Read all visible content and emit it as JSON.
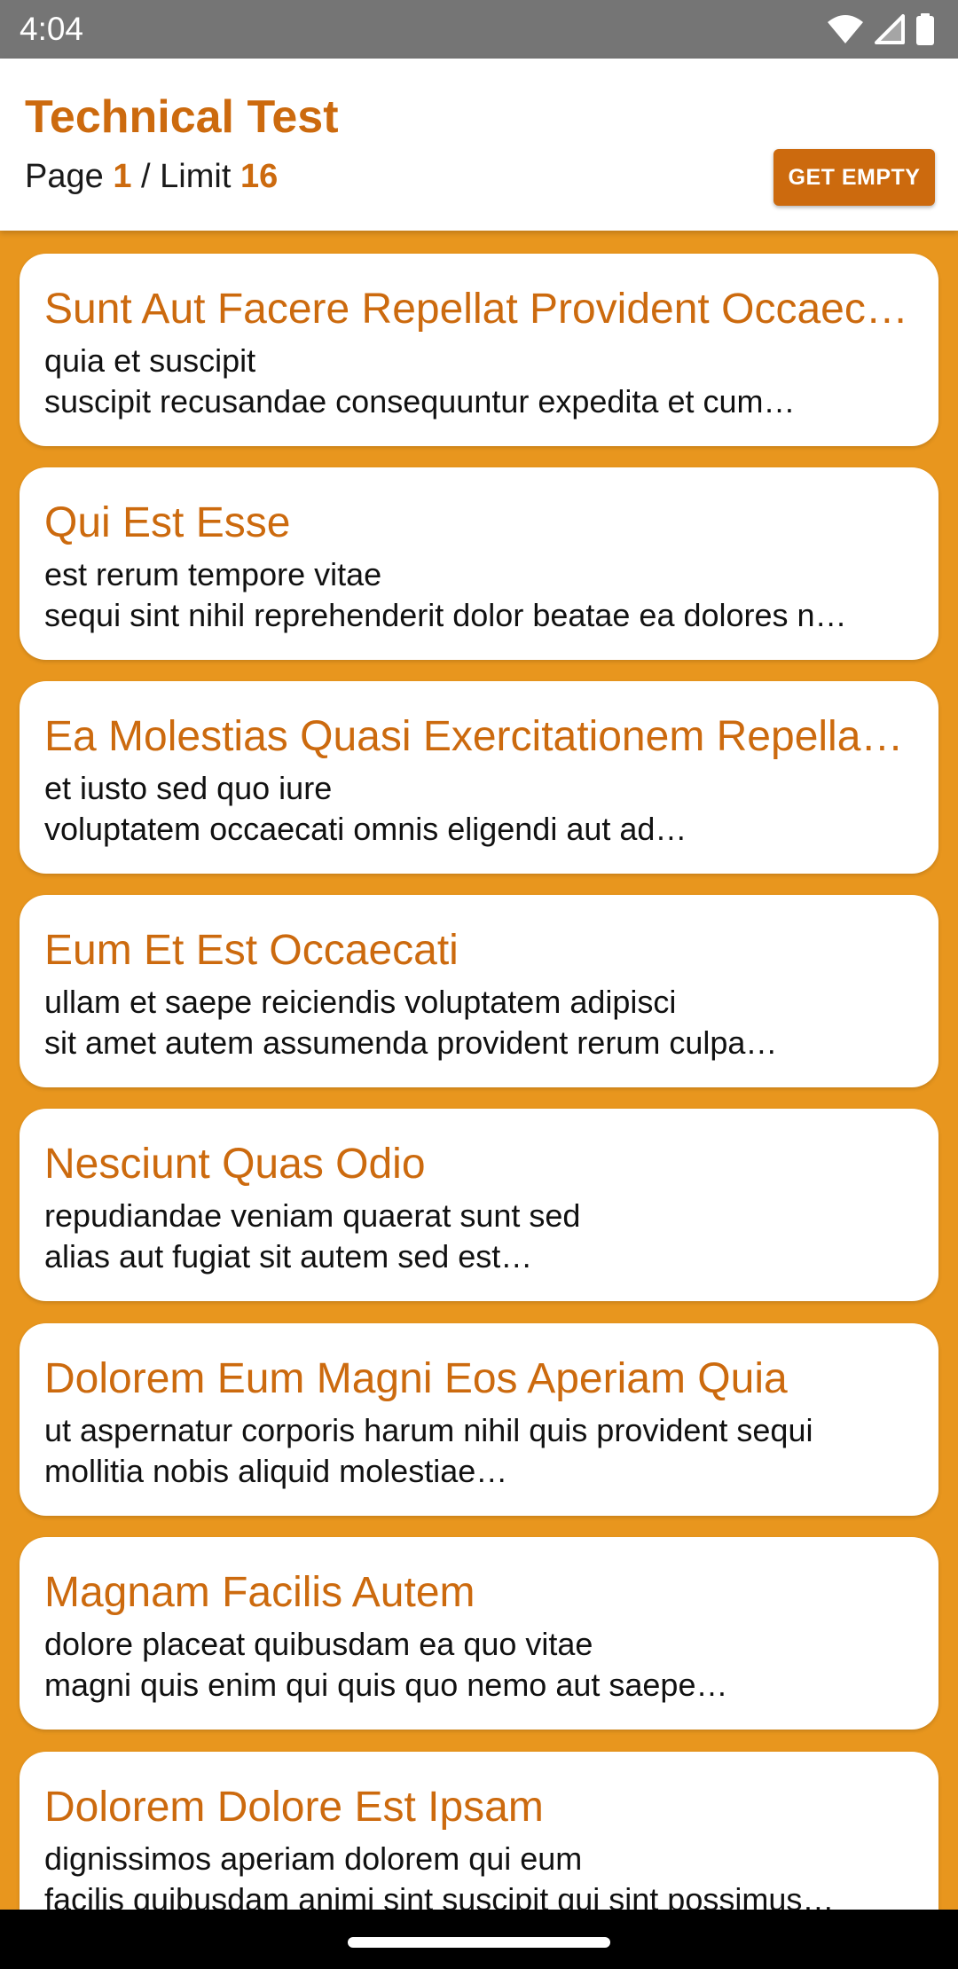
{
  "status_bar": {
    "time": "4:04"
  },
  "header": {
    "title": "Technical Test",
    "page_label": "Page",
    "page_value": "1",
    "separator": "/",
    "limit_label": "Limit",
    "limit_value": "16",
    "get_empty_label": "GET EMPTY"
  },
  "colors": {
    "accent": "#cc6a0e",
    "background": "#e8961e",
    "status_bar": "#757575"
  },
  "posts": [
    {
      "title": "Sunt Aut Facere Repellat Provident Occaecati Excepturi Optio Reprehenderit",
      "body_line1": "quia et suscipit",
      "body_line2": "suscipit recusandae consequuntur expedita et cum…"
    },
    {
      "title": "Qui Est Esse",
      "body_line1": "est rerum tempore vitae",
      "body_line2": "sequi sint nihil reprehenderit dolor beatae ea dolores n…"
    },
    {
      "title": "Ea Molestias Quasi Exercitationem Repellat Qui Ipsa Sit Aut",
      "body_line1": "et iusto sed quo iure",
      "body_line2": "voluptatem occaecati omnis eligendi aut ad…"
    },
    {
      "title": "Eum Et Est Occaecati",
      "body_line1": "ullam et saepe reiciendis voluptatem adipisci",
      "body_line2": "sit amet autem assumenda provident rerum culpa…"
    },
    {
      "title": "Nesciunt Quas Odio",
      "body_line1": "repudiandae veniam quaerat sunt sed",
      "body_line2": "alias aut fugiat sit autem sed est…"
    },
    {
      "title": "Dolorem Eum Magni Eos Aperiam Quia",
      "body_line1": "ut aspernatur corporis harum nihil quis provident sequi",
      "body_line2": "mollitia nobis aliquid molestiae…"
    },
    {
      "title": "Magnam Facilis Autem",
      "body_line1": "dolore placeat quibusdam ea quo vitae",
      "body_line2": "magni quis enim qui quis quo nemo aut saepe…"
    },
    {
      "title": "Dolorem Dolore Est Ipsam",
      "body_line1": "dignissimos aperiam dolorem qui eum",
      "body_line2": "facilis quibusdam animi sint suscipit qui sint possimus…"
    }
  ]
}
